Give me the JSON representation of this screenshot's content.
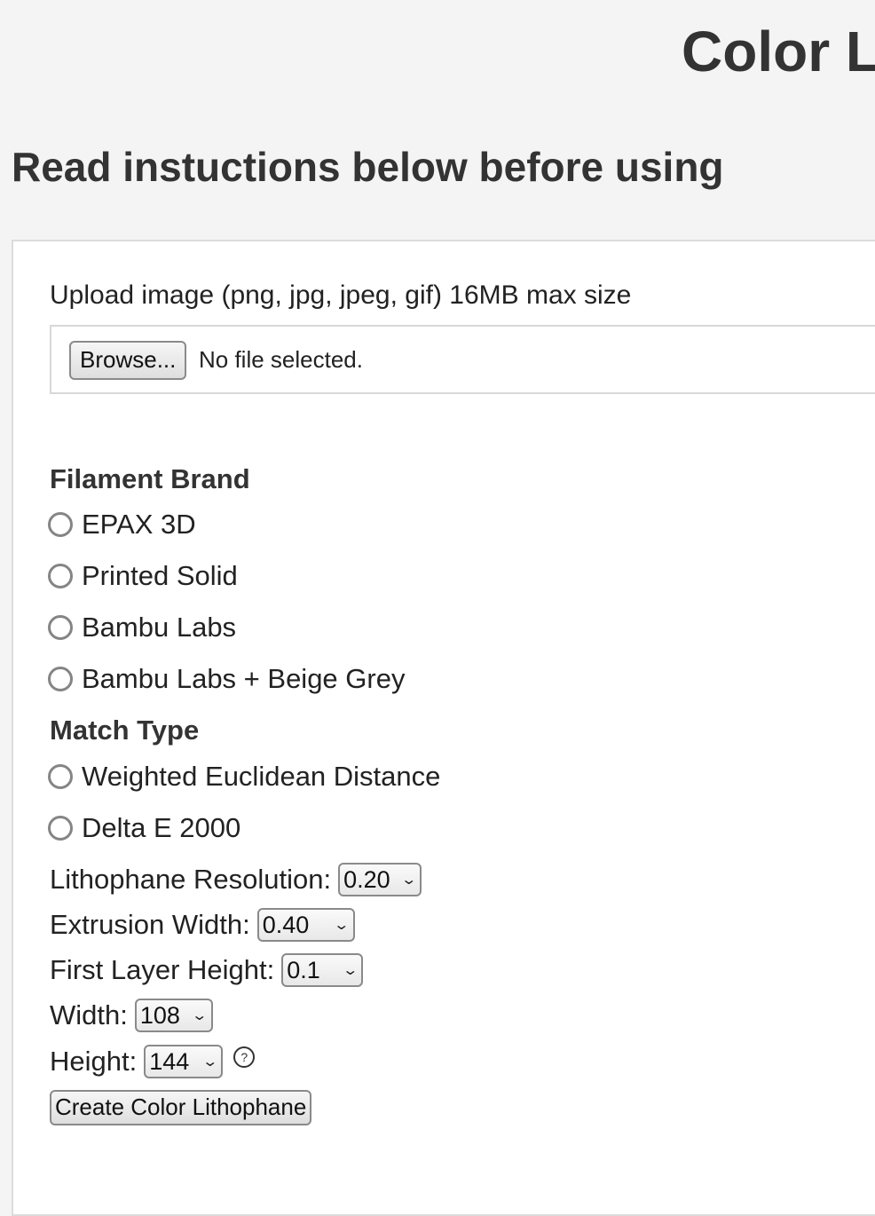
{
  "header": {
    "title": "Color L",
    "subtitle": "Read instuctions below before using"
  },
  "upload": {
    "label": "Upload image (png, jpg, jpeg, gif) 16MB max size",
    "browse_label": "Browse...",
    "status": "No file selected."
  },
  "filament_brand": {
    "title": "Filament Brand",
    "options": [
      "EPAX 3D",
      "Printed Solid",
      "Bambu Labs",
      "Bambu Labs + Beige Grey"
    ]
  },
  "match_type": {
    "title": "Match Type",
    "options": [
      "Weighted Euclidean Distance",
      "Delta E 2000"
    ]
  },
  "settings": {
    "resolution": {
      "label": "Lithophane Resolution:",
      "value": "0.20"
    },
    "extrusion_width": {
      "label": "Extrusion Width:",
      "value": "0.40"
    },
    "first_layer_height": {
      "label": "First Layer Height:",
      "value": "0.1"
    },
    "width": {
      "label": "Width:",
      "value": "108"
    },
    "height": {
      "label": "Height:",
      "value": "144"
    },
    "help_symbol": "?"
  },
  "submit": {
    "label": "Create Color Lithophane"
  },
  "icons": {
    "chevron": "chevron-down-icon",
    "help": "help-icon"
  }
}
